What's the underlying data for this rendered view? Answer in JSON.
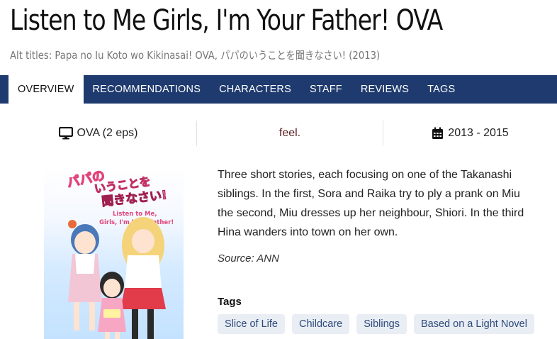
{
  "page": {
    "title": "Listen to Me Girls, I'm Your Father! OVA",
    "alt_titles_prefix": "Alt titles:",
    "alt_titles": "Papa no Iu Koto wo Kikinasai! OVA, パパのいうことを聞きなさい! (2013)"
  },
  "nav": {
    "tabs": [
      {
        "label": "OVERVIEW",
        "active": true
      },
      {
        "label": "RECOMMENDATIONS"
      },
      {
        "label": "CHARACTERS"
      },
      {
        "label": "STAFF"
      },
      {
        "label": "REVIEWS"
      },
      {
        "label": "TAGS"
      }
    ]
  },
  "info": {
    "format": "OVA (2 eps)",
    "format_icon": "monitor-icon",
    "studio": "feel.",
    "years": "2013 - 2015",
    "years_icon": "calendar-icon"
  },
  "cover": {
    "logo_text": "パパのいうことを聞きなさい!",
    "subtitle_line1": "Listen to Me,",
    "subtitle_line2": "Girls, I'm Your Father!"
  },
  "synopsis": {
    "lines": [
      "Three short stories, each focusing on one of the Takanashi",
      "siblings. In the first, Sora and Raika try to ply a prank on Miu",
      "the second, Miu dresses up her neighbour, Shiori. In the third",
      "Hina wanders into town on her own."
    ],
    "source": "Source: ANN"
  },
  "tags": {
    "heading": "Tags",
    "items": [
      "Slice of Life",
      "Childcare",
      "Siblings",
      "Based on a Light Novel"
    ]
  },
  "colors": {
    "nav_bg": "#1e3a6e",
    "tag_bg": "#e9edf4",
    "tag_text": "#2e4a7a",
    "studio_text": "#5a1f1f"
  }
}
